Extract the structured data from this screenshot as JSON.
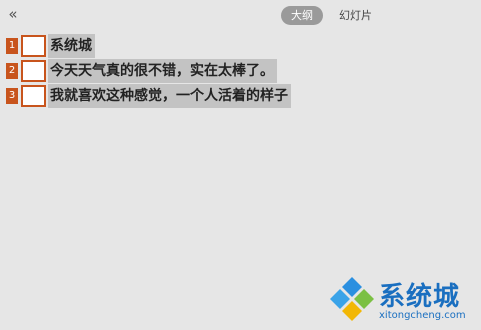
{
  "toolbar": {
    "collapse_icon": "double-chevron-left-icon",
    "collapse_glyph": "«"
  },
  "tabs": [
    {
      "label": "大纲",
      "active": true
    },
    {
      "label": "幻灯片",
      "active": false
    }
  ],
  "outline": {
    "items": [
      {
        "number": "1",
        "text": "系统城"
      },
      {
        "number": "2",
        "text": "今天天气真的很不错，实在太棒了。"
      },
      {
        "number": "3",
        "text": "我就喜欢这种感觉，一个人活着的样子"
      }
    ]
  },
  "watermark": {
    "title": "系统城",
    "url": "xitongcheng.com"
  },
  "colors": {
    "background": "#e6e6e6",
    "accent": "#c8541c",
    "active_tab": "#9a9a9a",
    "text_highlight": "#c3c3c3",
    "watermark_blue": "#1a6fc0"
  }
}
